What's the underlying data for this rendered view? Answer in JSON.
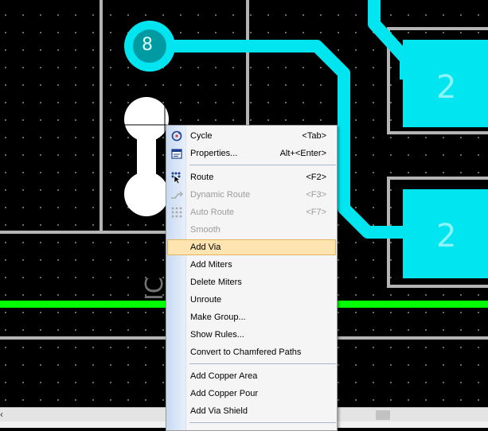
{
  "canvas": {
    "background": "#000000",
    "copper_color": "#00e5f0",
    "net_line_color": "#00ff00",
    "outline_color": "#b5b5b5",
    "pad_labels": [
      "2",
      "2"
    ],
    "pin_label": "8",
    "silkscreen_text": "IC"
  },
  "context_menu": {
    "highlight_color": "#fde4b0",
    "items": [
      {
        "label": "Cycle",
        "shortcut": "<Tab>",
        "icon": "cycle-icon",
        "enabled": true
      },
      {
        "label": "Properties...",
        "shortcut": "Alt+<Enter>",
        "icon": "properties-icon",
        "enabled": true
      },
      {
        "label": "Route",
        "shortcut": "<F2>",
        "icon": "route-icon",
        "enabled": true
      },
      {
        "label": "Dynamic Route",
        "shortcut": "<F3>",
        "icon": "dynamic-route-icon",
        "enabled": false
      },
      {
        "label": "Auto Route",
        "shortcut": "<F7>",
        "icon": "auto-route-icon",
        "enabled": false
      },
      {
        "label": "Smooth",
        "shortcut": "",
        "enabled": false
      },
      {
        "label": "Add Via",
        "shortcut": "",
        "enabled": true,
        "highlighted": true
      },
      {
        "label": "Add Miters",
        "shortcut": "",
        "enabled": true
      },
      {
        "label": "Delete Miters",
        "shortcut": "",
        "enabled": true
      },
      {
        "label": "Unroute",
        "shortcut": "",
        "enabled": true
      },
      {
        "label": "Make Group...",
        "shortcut": "",
        "enabled": true
      },
      {
        "label": "Show Rules...",
        "shortcut": "",
        "enabled": true
      },
      {
        "label": "Convert to Chamfered Paths",
        "shortcut": "",
        "enabled": true
      },
      {
        "label": "Add Copper Area",
        "shortcut": "",
        "enabled": true
      },
      {
        "label": "Add Copper Pour",
        "shortcut": "",
        "enabled": true
      },
      {
        "label": "Add Via Shield",
        "shortcut": "",
        "enabled": true
      }
    ]
  }
}
